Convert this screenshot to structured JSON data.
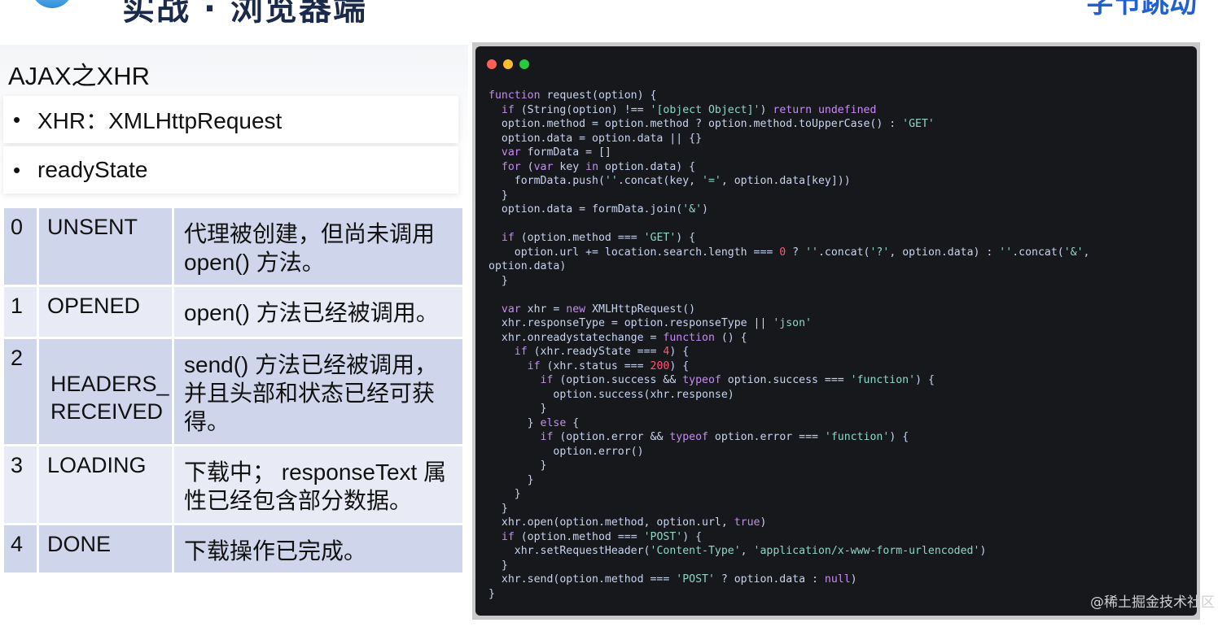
{
  "header": {
    "title": "实战 · 浏览器端",
    "brand": "字节跳动"
  },
  "slide": {
    "section_title": "AJAX之XHR",
    "bullets": [
      {
        "dot": "•",
        "label": "XHR：XMLHttpRequest"
      },
      {
        "dot": "•",
        "label": "readyState"
      }
    ],
    "ready_states": [
      {
        "value": "0",
        "name": "UNSENT",
        "description": "代理被创建，但尚未调用 open() 方法。"
      },
      {
        "value": "1",
        "name": "OPENED",
        "description": "open() 方法已经被调用。"
      },
      {
        "value": "2",
        "name": "HEADERS_ RECEIVED",
        "description": "send() 方法已经被调用，并且头部和状态已经可获得。"
      },
      {
        "value": "3",
        "name": "LOADING",
        "description": "下载中； responseText 属性已经包含部分数据。"
      },
      {
        "value": "4",
        "name": "DONE",
        "description": "下载操作已完成。"
      }
    ]
  },
  "code_window": {
    "lines": [
      "function request(option) {",
      "  if (String(option) !== '[object Object]') return undefined",
      "  option.method = option.method ? option.method.toUpperCase() : 'GET'",
      "  option.data = option.data || {}",
      "  var formData = []",
      "  for (var key in option.data) {",
      "    formData.push(''.concat(key, '=', option.data[key]))",
      "  }",
      "  option.data = formData.join('&')",
      "",
      "  if (option.method === 'GET') {",
      "    option.url += location.search.length === 0 ? ''.concat('?', option.data) : ''.concat('&',",
      "option.data)",
      "  }",
      "",
      "  var xhr = new XMLHttpRequest()",
      "  xhr.responseType = option.responseType || 'json'",
      "  xhr.onreadystatechange = function () {",
      "    if (xhr.readyState === 4) {",
      "      if (xhr.status === 200) {",
      "        if (option.success && typeof option.success === 'function') {",
      "          option.success(xhr.response)",
      "        }",
      "      } else {",
      "        if (option.error && typeof option.error === 'function') {",
      "          option.error()",
      "        }",
      "      }",
      "    }",
      "  }",
      "  xhr.open(option.method, option.url, true)",
      "  if (option.method === 'POST') {",
      "    xhr.setRequestHeader('Content-Type', 'application/x-www-form-urlencoded')",
      "  }",
      "  xhr.send(option.method === 'POST' ? option.data : null)",
      "}"
    ]
  },
  "watermark": "@稀土掘金技术社区",
  "colors": {
    "table_row_dark": "#cfd5ea",
    "table_row_light": "#e8ebf5",
    "code_bg": "#16181c",
    "code_text": "#c8d3f0"
  }
}
